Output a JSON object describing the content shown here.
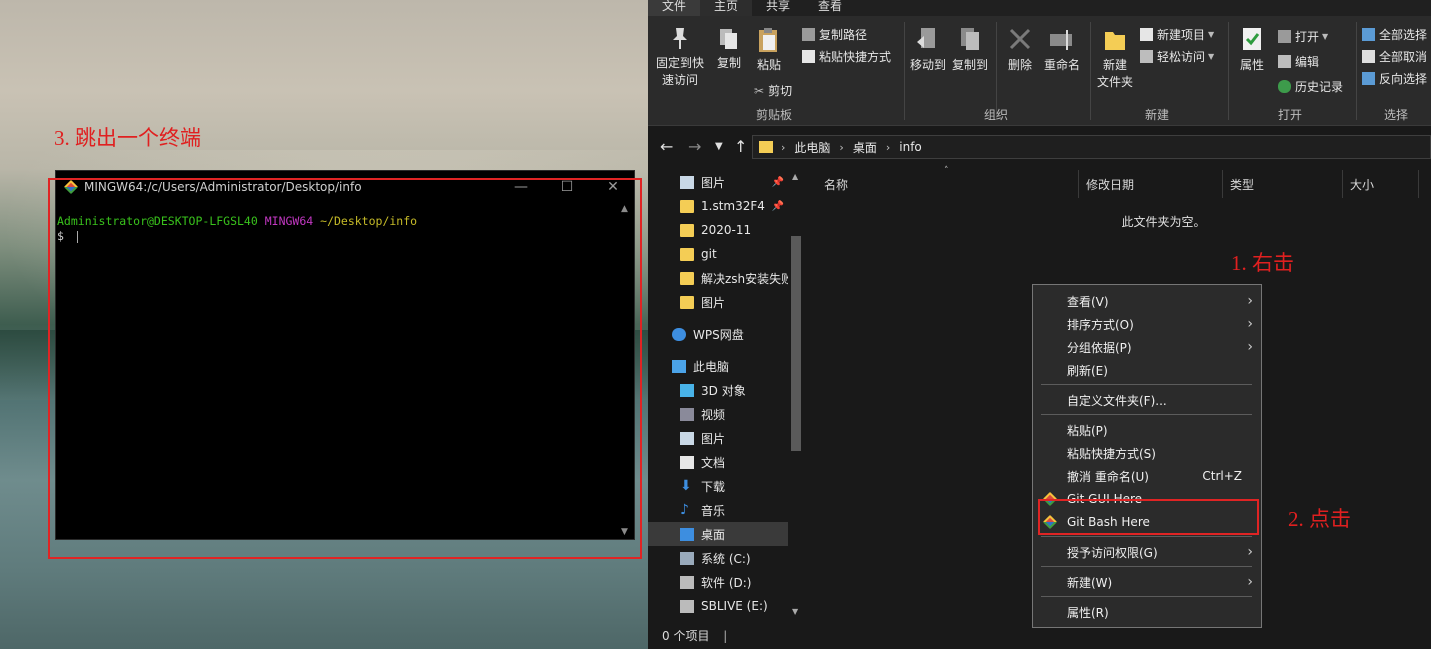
{
  "annotations": {
    "step1": "1.  右击",
    "step2": "2. 点击",
    "step3": "3.  跳出一个终端"
  },
  "terminal": {
    "title": "MINGW64:/c/Users/Administrator/Desktop/info",
    "prompt_user": "Administrator@DESKTOP-LFGSL40",
    "prompt_env": "MINGW64",
    "prompt_path": "~/Desktop/info",
    "prompt_symbol": "$",
    "minimize": "—",
    "maximize": "☐",
    "close": "✕"
  },
  "explorer": {
    "menu_tabs": [
      "文件",
      "主页",
      "共享",
      "查看"
    ],
    "ribbon": {
      "pin_quick_access": "固定到快\n速访问",
      "copy": "复制",
      "paste": "粘贴",
      "copy_path": "复制路径",
      "paste_shortcut": "粘贴快捷方式",
      "cut": "剪切",
      "clipboard_group": "剪贴板",
      "move_to": "移动到",
      "copy_to": "复制到",
      "delete": "删除",
      "rename": "重命名",
      "organize_group": "组织",
      "new_folder": "新建\n文件夹",
      "new_item": "新建项目",
      "easy_access": "轻松访问",
      "new_group": "新建",
      "properties": "属性",
      "open": "打开",
      "edit": "编辑",
      "history": "历史记录",
      "open_group": "打开",
      "select_all": "全部选择",
      "select_none": "全部取消",
      "invert_selection": "反向选择",
      "select_group": "选择"
    },
    "address": {
      "crumbs": [
        "此电脑",
        "桌面",
        "info"
      ]
    },
    "nav": [
      {
        "label": "图片",
        "pinned": true
      },
      {
        "label": "1.stm32F4",
        "pinned": true
      },
      {
        "label": "2020-11",
        "pinned": false
      },
      {
        "label": "git",
        "pinned": false
      },
      {
        "label": "解决zsh安装失败",
        "pinned": false
      },
      {
        "label": "图片",
        "pinned": false
      },
      {
        "label": "WPS网盘",
        "pinned": false
      },
      {
        "label": "此电脑",
        "pinned": false
      },
      {
        "label": "3D 对象",
        "pinned": false
      },
      {
        "label": "视频",
        "pinned": false
      },
      {
        "label": "图片",
        "pinned": false
      },
      {
        "label": "文档",
        "pinned": false
      },
      {
        "label": "下载",
        "pinned": false
      },
      {
        "label": "音乐",
        "pinned": false
      },
      {
        "label": "桌面",
        "pinned": false,
        "selected": true
      },
      {
        "label": "系统 (C:)",
        "pinned": false
      },
      {
        "label": "软件 (D:)",
        "pinned": false
      },
      {
        "label": "SBLIVE (E:)",
        "pinned": false
      }
    ],
    "columns": [
      "名称",
      "修改日期",
      "类型",
      "大小"
    ],
    "empty_message": "此文件夹为空。",
    "status": "0 个项目"
  },
  "context_menu": {
    "items": [
      {
        "label": "查看(V)",
        "submenu": true
      },
      {
        "label": "排序方式(O)",
        "submenu": true
      },
      {
        "label": "分组依据(P)",
        "submenu": true
      },
      {
        "label": "刷新(E)",
        "submenu": false
      },
      {
        "label": "自定义文件夹(F)...",
        "submenu": false
      },
      {
        "label": "粘贴(P)",
        "submenu": false
      },
      {
        "label": "粘贴快捷方式(S)",
        "submenu": false
      },
      {
        "label": "撤消 重命名(U)",
        "submenu": false,
        "shortcut": "Ctrl+Z"
      },
      {
        "label": "Git GUI Here",
        "submenu": false,
        "icon": "git-icon"
      },
      {
        "label": "Git Bash Here",
        "submenu": false,
        "icon": "git-icon"
      },
      {
        "label": "授予访问权限(G)",
        "submenu": true
      },
      {
        "label": "新建(W)",
        "submenu": true
      },
      {
        "label": "属性(R)",
        "submenu": false
      }
    ]
  },
  "colors": {
    "annotation_red": "#e02424",
    "term_green": "#39c21c",
    "term_magenta": "#c238c2",
    "term_yellow": "#c6bb28"
  }
}
